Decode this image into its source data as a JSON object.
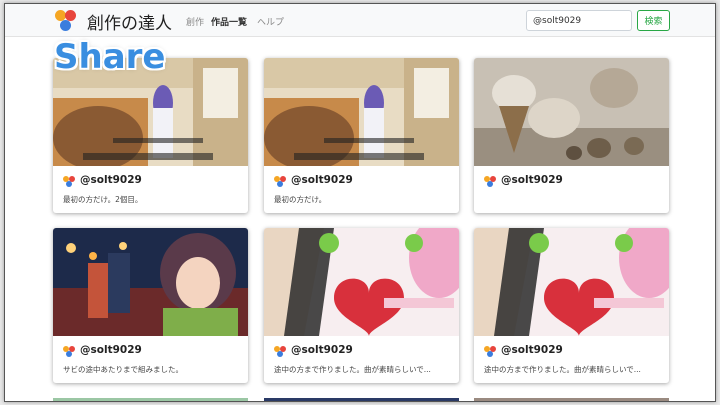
{
  "app": {
    "brand": "創作の達人",
    "logo_colors": [
      "#f5a623",
      "#e8453c",
      "#3b7ddd"
    ]
  },
  "nav": {
    "items": [
      {
        "label": "創作",
        "active": false
      },
      {
        "label": "作品一覧",
        "active": true
      },
      {
        "label": "ヘルプ",
        "active": false
      }
    ]
  },
  "search": {
    "value": "@solt9029",
    "button_label": "検索"
  },
  "overlay": {
    "text": "Share"
  },
  "cards": [
    {
      "user": "@solt9029",
      "description": "最初の方だけ。2個目。",
      "image": "anime-hallway"
    },
    {
      "user": "@solt9029",
      "description": "最初の方だけ。",
      "image": "anime-hallway"
    },
    {
      "user": "@solt9029",
      "description": "",
      "image": "ice-cream"
    },
    {
      "user": "@solt9029",
      "description": "サビの途中あたりまで組みました。",
      "image": "festival-night"
    },
    {
      "user": "@solt9029",
      "description": "途中の方まで作りました。曲が素晴らしいで...",
      "image": "pink-heart"
    },
    {
      "user": "@solt9029",
      "description": "途中の方まで作りました。曲が素晴らしいで...",
      "image": "pink-heart"
    }
  ]
}
